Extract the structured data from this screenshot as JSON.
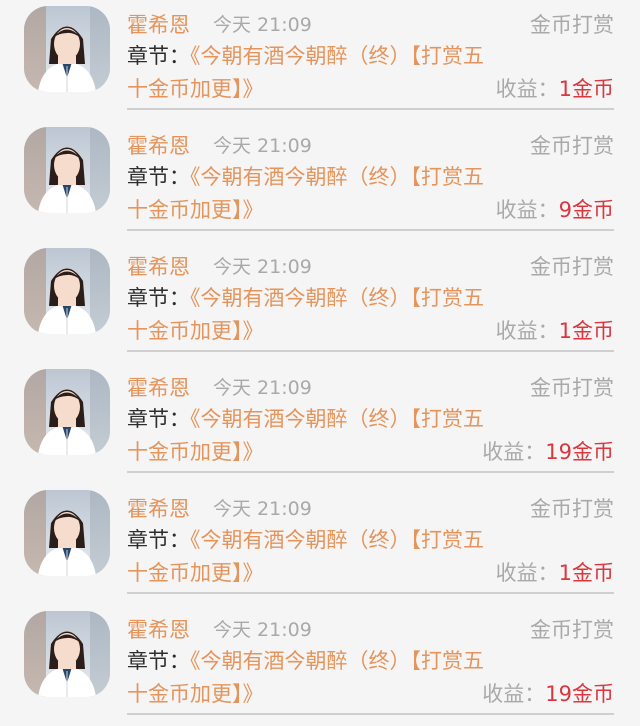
{
  "notifications": [
    {
      "user_name": "霍希恩",
      "time": "今天 21:09",
      "type_label": "金币打赏",
      "chapter_prefix": "章节：",
      "chapter_title": "《今朝有酒今朝醉（终）【打赏五十金币加更】》",
      "income_label": "收益：",
      "income_value": "1金币",
      "avatar_icon": "person-avatar"
    },
    {
      "user_name": "霍希恩",
      "time": "今天 21:09",
      "type_label": "金币打赏",
      "chapter_prefix": "章节：",
      "chapter_title": "《今朝有酒今朝醉（终）【打赏五十金币加更】》",
      "income_label": "收益：",
      "income_value": "9金币",
      "avatar_icon": "person-avatar"
    },
    {
      "user_name": "霍希恩",
      "time": "今天 21:09",
      "type_label": "金币打赏",
      "chapter_prefix": "章节：",
      "chapter_title": "《今朝有酒今朝醉（终）【打赏五十金币加更】》",
      "income_label": "收益：",
      "income_value": "1金币",
      "avatar_icon": "person-avatar"
    },
    {
      "user_name": "霍希恩",
      "time": "今天 21:09",
      "type_label": "金币打赏",
      "chapter_prefix": "章节：",
      "chapter_title": "《今朝有酒今朝醉（终）【打赏五十金币加更】》",
      "income_label": "收益：",
      "income_value": "19金币",
      "avatar_icon": "person-avatar"
    },
    {
      "user_name": "霍希恩",
      "time": "今天 21:09",
      "type_label": "金币打赏",
      "chapter_prefix": "章节：",
      "chapter_title": "《今朝有酒今朝醉（终）【打赏五十金币加更】》",
      "income_label": "收益：",
      "income_value": "1金币",
      "avatar_icon": "person-avatar"
    },
    {
      "user_name": "霍希恩",
      "time": "今天 21:09",
      "type_label": "金币打赏",
      "chapter_prefix": "章节：",
      "chapter_title": "《今朝有酒今朝醉（终）【打赏五十金币加更】》",
      "income_label": "收益：",
      "income_value": "19金币",
      "avatar_icon": "person-avatar"
    }
  ],
  "colors": {
    "background": "#f5f5f5",
    "accent": "#e5945b",
    "income": "#d9363e",
    "muted": "#a9a9a9",
    "text": "#2d2d2d",
    "divider": "#cfcfcf"
  }
}
